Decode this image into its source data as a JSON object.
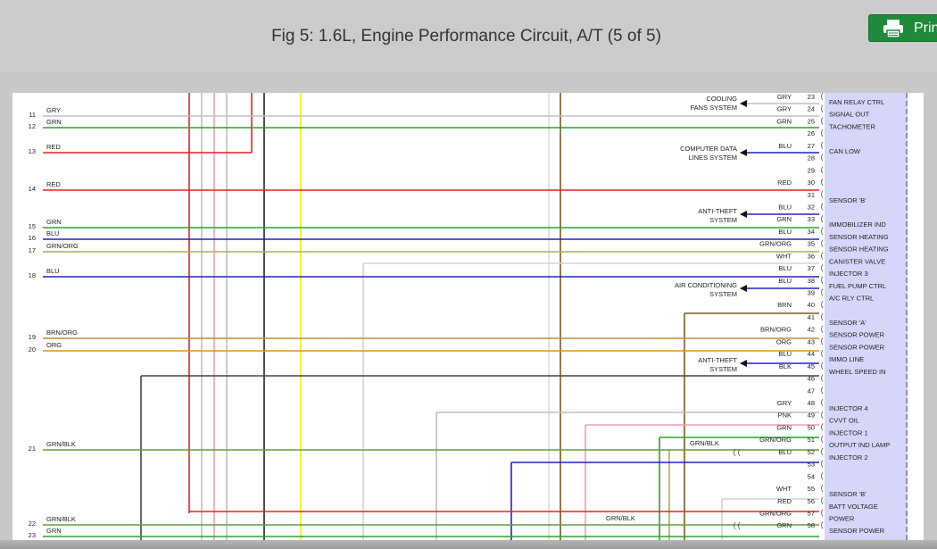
{
  "header": {
    "title": "Fig 5: 1.6L, Engine Performance Circuit, A/T (5 of 5)",
    "print_label": "Print"
  },
  "diagram": {
    "connector_color": "#d6d6fb",
    "left_rows": [
      {
        "num": "11",
        "label": "GRY",
        "color": "#bfbfbf"
      },
      {
        "num": "12",
        "label": "GRN",
        "color": "#2da02d"
      },
      {
        "num": "13",
        "label": "RED",
        "color": "#e82020"
      },
      {
        "num": "14",
        "label": "RED",
        "color": "#e82020"
      },
      {
        "num": "15",
        "label": "GRN",
        "color": "#2da02d"
      },
      {
        "num": "16",
        "label": "BLU",
        "color": "#2020c8"
      },
      {
        "num": "17",
        "label": "GRN/ORG",
        "color": "#a8ae55"
      },
      {
        "num": "18",
        "label": "BLU",
        "color": "#2020c8"
      },
      {
        "num": "19",
        "label": "BRN/ORG",
        "color": "#c88a3c"
      },
      {
        "num": "20",
        "label": "ORG",
        "color": "#f08a1e"
      },
      {
        "num": "21",
        "label": "GRN/BLK",
        "color": "#6a9a40"
      },
      {
        "num": "22",
        "label": "GRN/BLK",
        "color": "#6a9a40"
      },
      {
        "num": "23",
        "label": "GRN",
        "color": "#2da02d"
      }
    ],
    "pins": [
      {
        "num": "23",
        "wire": "GRY",
        "func": "FAN RELAY CTRL"
      },
      {
        "num": "24",
        "wire": "GRY",
        "func": "SIGNAL OUT"
      },
      {
        "num": "25",
        "wire": "GRN",
        "func": "TACHOMETER"
      },
      {
        "num": "26",
        "wire": "",
        "func": ""
      },
      {
        "num": "27",
        "wire": "BLU",
        "func": "CAN LOW"
      },
      {
        "num": "28",
        "wire": "",
        "func": ""
      },
      {
        "num": "29",
        "wire": "",
        "func": ""
      },
      {
        "num": "30",
        "wire": "RED",
        "func": ""
      },
      {
        "num": "31",
        "wire": "",
        "func": "SENSOR 'B'"
      },
      {
        "num": "32",
        "wire": "BLU",
        "func": ""
      },
      {
        "num": "33",
        "wire": "GRN",
        "func": "IMMOBILIZER IND"
      },
      {
        "num": "34",
        "wire": "BLU",
        "func": "SENSOR HEATING"
      },
      {
        "num": "35",
        "wire": "GRN/ORG",
        "func": "SENSOR HEATING"
      },
      {
        "num": "36",
        "wire": "WHT",
        "func": "CANISTER VALVE"
      },
      {
        "num": "37",
        "wire": "BLU",
        "func": "INJECTOR 3"
      },
      {
        "num": "38",
        "wire": "BLU",
        "func": "FUEL PUMP CTRL"
      },
      {
        "num": "39",
        "wire": "",
        "func": "A/C RLY CTRL"
      },
      {
        "num": "40",
        "wire": "BRN",
        "func": ""
      },
      {
        "num": "41",
        "wire": "",
        "func": "SENSOR 'A'"
      },
      {
        "num": "42",
        "wire": "BRN/ORG",
        "func": "SENSOR POWER"
      },
      {
        "num": "43",
        "wire": "ORG",
        "func": "SENSOR POWER"
      },
      {
        "num": "44",
        "wire": "BLU",
        "func": "IMMO LINE"
      },
      {
        "num": "45",
        "wire": "BLK",
        "func": "WHEEL SPEED IN"
      },
      {
        "num": "46",
        "wire": "",
        "func": ""
      },
      {
        "num": "47",
        "wire": "",
        "func": ""
      },
      {
        "num": "48",
        "wire": "GRY",
        "func": "INJECTOR 4"
      },
      {
        "num": "49",
        "wire": "PNK",
        "func": "CVVT OIL"
      },
      {
        "num": "50",
        "wire": "GRN",
        "func": "INJECTOR 1"
      },
      {
        "num": "51",
        "wire": "GRN/ORG",
        "func": "OUTPUT IND LAMP"
      },
      {
        "num": "52",
        "wire": "BLU",
        "func": "INJECTOR 2"
      },
      {
        "num": "53",
        "wire": "",
        "func": ""
      },
      {
        "num": "54",
        "wire": "",
        "func": ""
      },
      {
        "num": "55",
        "wire": "WHT",
        "func": "SENSOR 'B'"
      },
      {
        "num": "56",
        "wire": "RED",
        "func": "BATT VOLTAGE"
      },
      {
        "num": "57",
        "wire": "GRN/ORG",
        "func": "POWER"
      },
      {
        "num": "58",
        "wire": "GRN",
        "func": "SENSOR POWER"
      }
    ],
    "systems": [
      {
        "lines": [
          "COOLING",
          "FANS SYSTEM"
        ]
      },
      {
        "lines": [
          "COMPUTER DATA",
          "LINES SYSTEM"
        ]
      },
      {
        "lines": [
          "ANTI-THEFT",
          "SYSTEM"
        ]
      },
      {
        "lines": [
          "AIR CONDITIONING",
          "SYSTEM"
        ]
      },
      {
        "lines": [
          "ANTI-THEFT",
          "SYSTEM"
        ]
      }
    ],
    "mid_labels": [
      "GRN/BLK",
      "GRN/BLK"
    ],
    "wire_colors": {
      "GRY": "#bfbfbf",
      "GRN": "#2da02d",
      "RED": "#e82020",
      "BLU": "#2020c8",
      "GRN/ORG": "#a8ae55",
      "WHT": "#d2d2d2",
      "BRN": "#7a5a20",
      "BRN/ORG": "#c88a3c",
      "ORG": "#f08a1e",
      "BLK": "#444444",
      "PNK": "#f39ab8",
      "GRN/BLK": "#6a9a40",
      "YEL": "#f5f000"
    }
  }
}
